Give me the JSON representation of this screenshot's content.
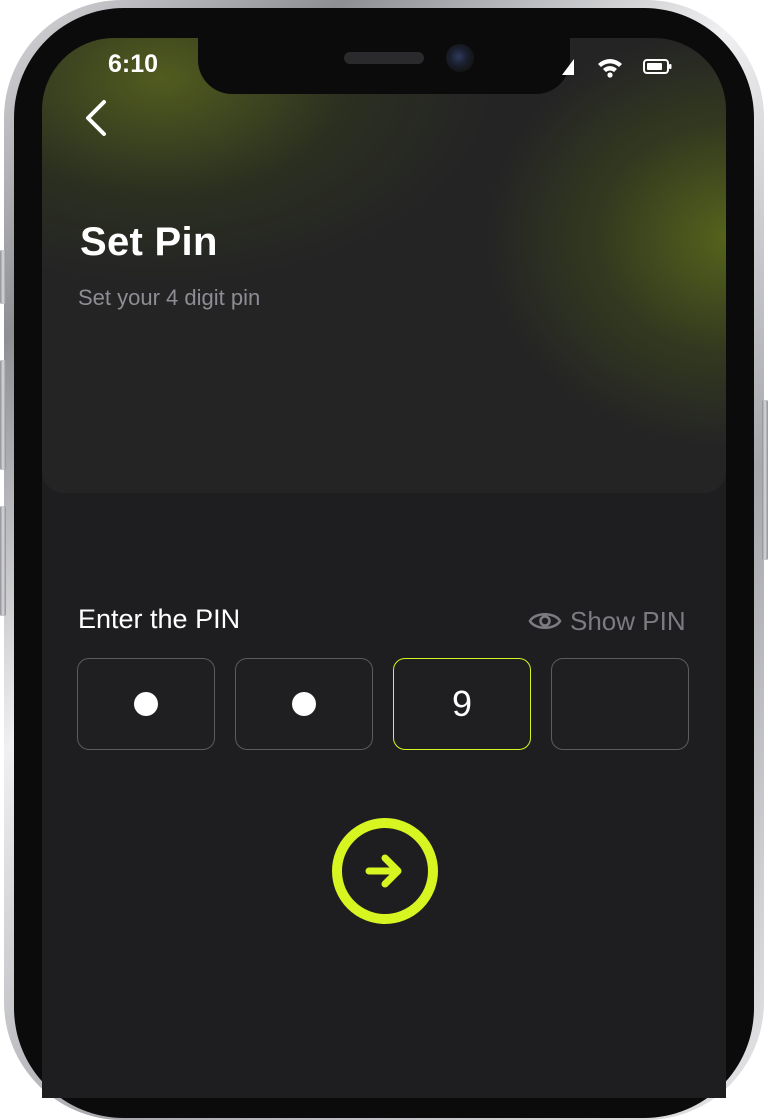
{
  "status_bar": {
    "time": "6:10"
  },
  "header": {
    "title": "Set Pin",
    "subtitle": "Set your 4 digit pin"
  },
  "pin_entry": {
    "label": "Enter the PIN",
    "show_pin_label": "Show PIN",
    "digits": [
      "",
      "",
      "9",
      ""
    ],
    "masked": [
      true,
      true,
      false,
      false
    ]
  },
  "icons": {
    "back": "chevron-left-icon",
    "show_pin": "eye-icon",
    "next": "arrow-right-icon"
  },
  "colors": {
    "accent": "#d7f521",
    "background": "#1e1e20",
    "muted_text": "#8d8d94"
  }
}
